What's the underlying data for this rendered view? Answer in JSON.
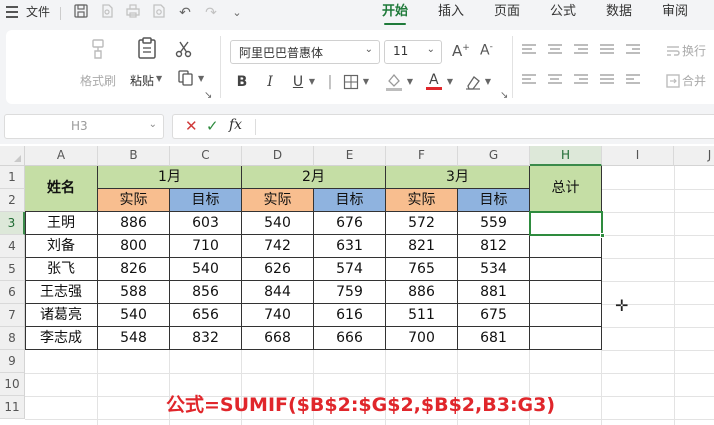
{
  "menu": {
    "file_label": "文件",
    "tabs": [
      {
        "label": "开始",
        "active": true
      },
      {
        "label": "插入",
        "active": false
      },
      {
        "label": "页面",
        "active": false
      },
      {
        "label": "公式",
        "active": false
      },
      {
        "label": "数据",
        "active": false
      },
      {
        "label": "审阅",
        "active": false
      }
    ]
  },
  "ribbon": {
    "format_painter_label": "格式刷",
    "paste_label": "粘贴",
    "font_name": "阿里巴巴普惠体",
    "font_size": "11",
    "bold": "B",
    "italic": "I",
    "underline": "U",
    "wrap_label": "换行",
    "merge_label": "合并"
  },
  "formula_bar": {
    "name_box": "H3",
    "fx_label": "fx",
    "value": ""
  },
  "sheet": {
    "columns": [
      "A",
      "B",
      "C",
      "D",
      "E",
      "F",
      "G",
      "H",
      "I",
      "J"
    ],
    "rows": [
      "1",
      "2",
      "3",
      "4",
      "5",
      "6",
      "7",
      "8",
      "9",
      "10",
      "11"
    ],
    "selected_column": "H",
    "selected_row": "3",
    "header_name": "姓名",
    "months": [
      "1月",
      "2月",
      "3月"
    ],
    "sub_headers": [
      "实际",
      "目标",
      "实际",
      "目标",
      "实际",
      "目标"
    ],
    "total_header": "总计",
    "data_rows": [
      {
        "name": "王明",
        "values": [
          "886",
          "603",
          "540",
          "676",
          "572",
          "559"
        ]
      },
      {
        "name": "刘备",
        "values": [
          "800",
          "710",
          "742",
          "631",
          "821",
          "812"
        ]
      },
      {
        "name": "张飞",
        "values": [
          "826",
          "540",
          "626",
          "574",
          "765",
          "534"
        ]
      },
      {
        "name": "王志强",
        "values": [
          "588",
          "856",
          "844",
          "759",
          "886",
          "881"
        ]
      },
      {
        "name": "诸葛亮",
        "values": [
          "540",
          "656",
          "740",
          "616",
          "511",
          "675"
        ]
      },
      {
        "name": "李志成",
        "values": [
          "548",
          "832",
          "668",
          "666",
          "700",
          "681"
        ]
      }
    ]
  },
  "annotation": "公式=SUMIF($B$2:$G$2,$B$2,B3:G3)",
  "colors": {
    "header_green": "#c5dea5",
    "actual_orange": "#f8be8f",
    "target_blue": "#8fb3df",
    "accent_green": "#1f7a3a",
    "annotation_red": "#e0262b"
  }
}
